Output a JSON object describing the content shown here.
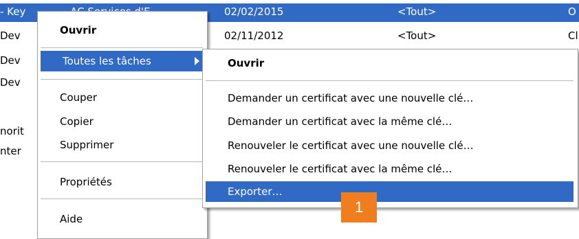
{
  "list": {
    "rows": [
      {
        "name": "- Key",
        "name_extra": "AC Services d'E...",
        "date": "02/02/2015",
        "purpose": "<Tout>",
        "last": "O",
        "selected": true
      },
      {
        "name": "Dev",
        "date": "02/11/2012",
        "purpose": "<Tout>",
        "last": "Cl"
      },
      {
        "name": "Dev",
        "date": "",
        "purpose": "",
        "last": ""
      },
      {
        "name": "Dev",
        "date": "",
        "purpose": "",
        "last": ""
      },
      {
        "name": "",
        "date": "",
        "purpose": "",
        "last": ""
      },
      {
        "name": "norit",
        "date": "",
        "purpose": "",
        "last": ""
      },
      {
        "name": "nter",
        "date": "",
        "purpose": "",
        "last": ""
      }
    ]
  },
  "context_menu": {
    "open": "Ouvrir",
    "all_tasks": "Toutes les tâches",
    "cut": "Couper",
    "copy": "Copier",
    "delete": "Supprimer",
    "properties": "Propriétés",
    "help": "Aide"
  },
  "submenu": {
    "open": "Ouvrir",
    "request_new_key": "Demander un certificat avec une nouvelle clé…",
    "request_same_key": "Demander un certificat avec la même clé…",
    "renew_new_key": "Renouveler le certificat avec une nouvelle clé…",
    "renew_same_key": "Renouveler le certificat avec la même clé…",
    "export": "Exporter…"
  },
  "callout": {
    "label": "1",
    "color": "#f07d1e"
  },
  "colors": {
    "selection": "#316ac5"
  }
}
